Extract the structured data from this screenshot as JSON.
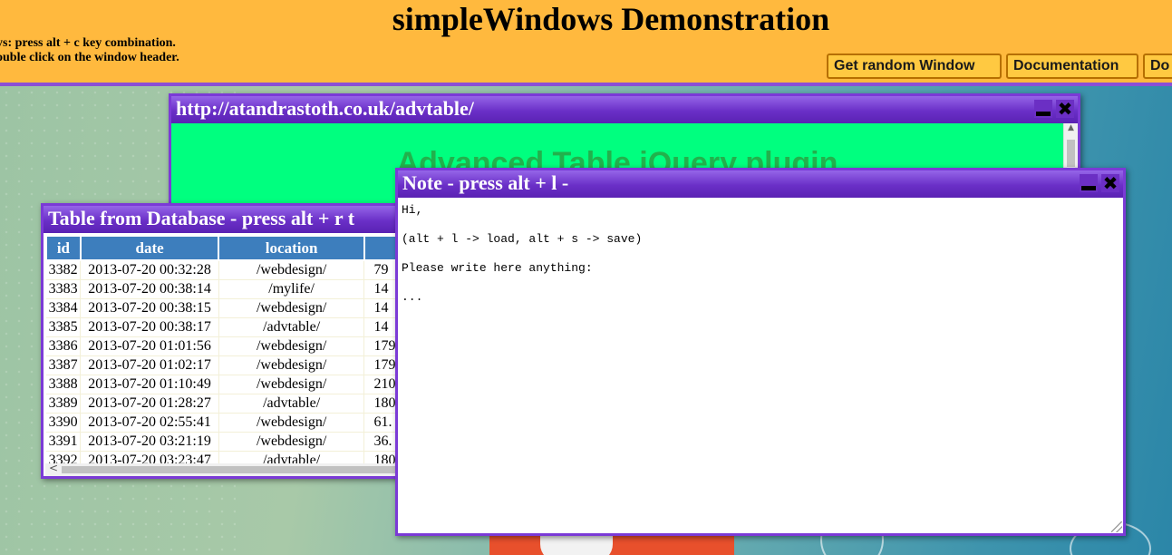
{
  "header": {
    "title": "simpleWindows Demonstration",
    "hints": [
      "ys: press alt + c key combination.",
      "ouble click on the window header."
    ],
    "buttons": [
      {
        "label": "Get random Window"
      },
      {
        "label": "Documentation"
      },
      {
        "label": "Do"
      }
    ]
  },
  "colors": {
    "header_bg": "#ffb93e",
    "window_header": "#6a2fc7",
    "table_header": "#3d7ebd",
    "url_body_bg": "#00ff7f"
  },
  "windows": {
    "url": {
      "title": "http://atandrastoth.co.uk/advtable/",
      "heading": "Advanced Table jQuery plugin"
    },
    "table": {
      "title": "Table from Database - press alt + r t",
      "columns": [
        "id",
        "date",
        "location",
        ""
      ],
      "rows": [
        [
          "3382",
          "2013-07-20 00:32:28",
          "/webdesign/",
          "79"
        ],
        [
          "3383",
          "2013-07-20 00:38:14",
          "/mylife/",
          "14"
        ],
        [
          "3384",
          "2013-07-20 00:38:15",
          "/webdesign/",
          "14"
        ],
        [
          "3385",
          "2013-07-20 00:38:17",
          "/advtable/",
          "14"
        ],
        [
          "3386",
          "2013-07-20 01:01:56",
          "/webdesign/",
          "179"
        ],
        [
          "3387",
          "2013-07-20 01:02:17",
          "/webdesign/",
          "179"
        ],
        [
          "3388",
          "2013-07-20 01:10:49",
          "/webdesign/",
          "210"
        ],
        [
          "3389",
          "2013-07-20 01:28:27",
          "/advtable/",
          "180"
        ],
        [
          "3390",
          "2013-07-20 02:55:41",
          "/webdesign/",
          "61."
        ],
        [
          "3391",
          "2013-07-20 03:21:19",
          "/webdesign/",
          "36."
        ],
        [
          "3392",
          "2013-07-20 03:23:47",
          "/advtable/",
          "180"
        ]
      ]
    },
    "note": {
      "title": "Note - press alt + l -",
      "content": "Hi,\n\n(alt + l -> load, alt + s -> save)\n\nPlease write here anything:\n\n..."
    }
  },
  "icons": {
    "minimize": "minimize-icon",
    "close": "close-icon",
    "scroll_up": "▲",
    "scroll_left": "<",
    "close_glyph": "✖"
  }
}
